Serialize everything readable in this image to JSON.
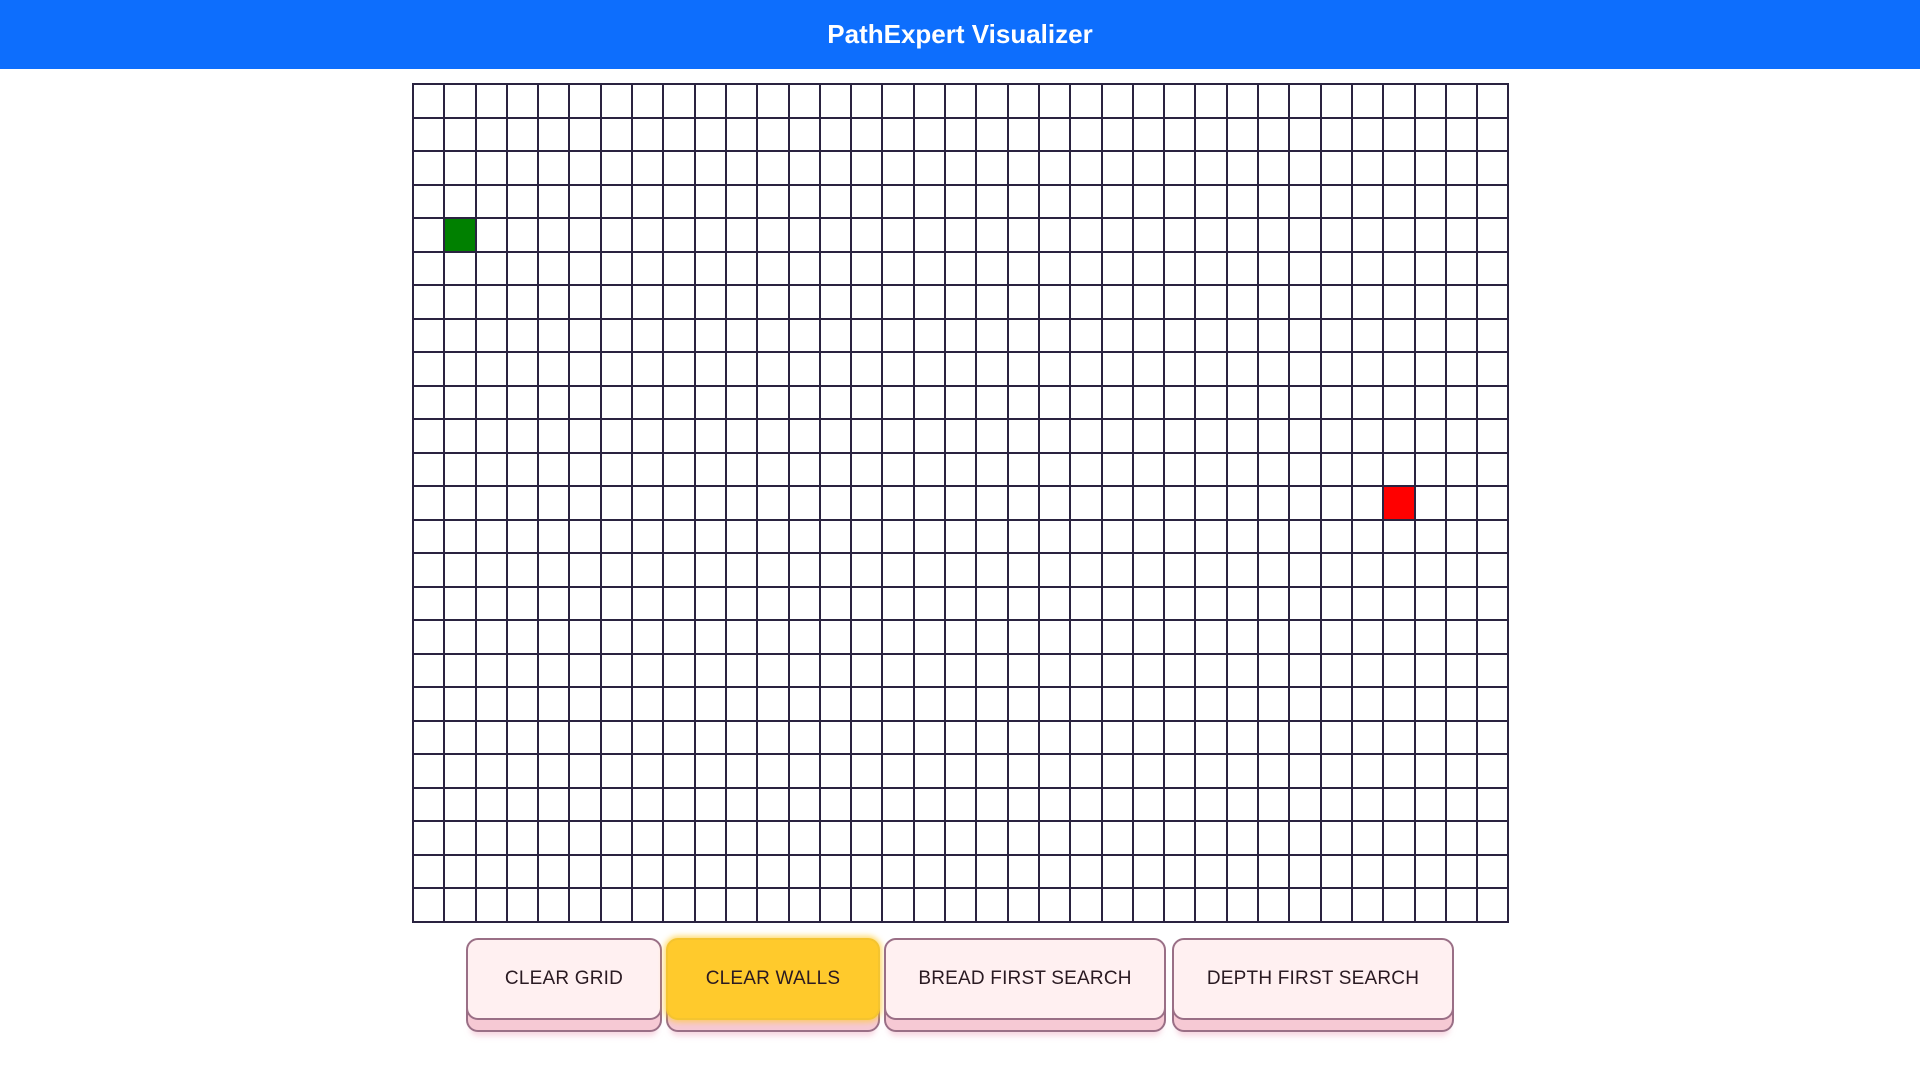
{
  "header": {
    "title": "PathExpert Visualizer",
    "background": "#0d6efd"
  },
  "grid": {
    "rows": 25,
    "cols": 35,
    "start_node": {
      "row": 4,
      "col": 1,
      "color": "#008000"
    },
    "target_node": {
      "row": 12,
      "col": 31,
      "color": "#ff0000"
    }
  },
  "controls": {
    "clear_grid_label": "CLEAR GRID",
    "clear_walls_label": "CLEAR WALLS",
    "bfs_label": "BREAD FIRST SEARCH",
    "dfs_label": "DEPTH FIRST SEARCH",
    "active_color": "#ffca2c"
  }
}
